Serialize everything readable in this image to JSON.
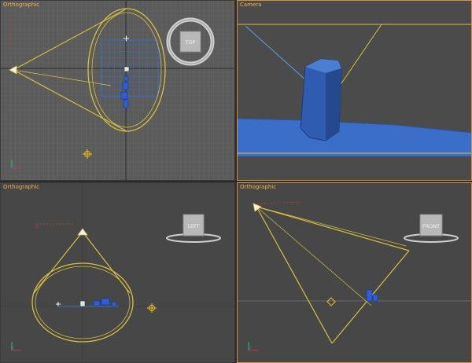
{
  "viewports": {
    "top_left": {
      "label": "Orthographic",
      "viewcube_face": "TOP"
    },
    "top_right": {
      "label": "Camera"
    },
    "bottom_left": {
      "label": "Orthographic",
      "viewcube_face": "LEFT"
    },
    "bottom_right": {
      "label": "Orthographic",
      "viewcube_face": "FRONT"
    }
  },
  "colors": {
    "viewport_bg": "#5b5b5b",
    "dark_viewport_bg": "#474747",
    "camera_cone": "#d8c040",
    "object_blue": "#3a6ec8",
    "active_border": "#d8903a",
    "label": "#f0b050"
  }
}
